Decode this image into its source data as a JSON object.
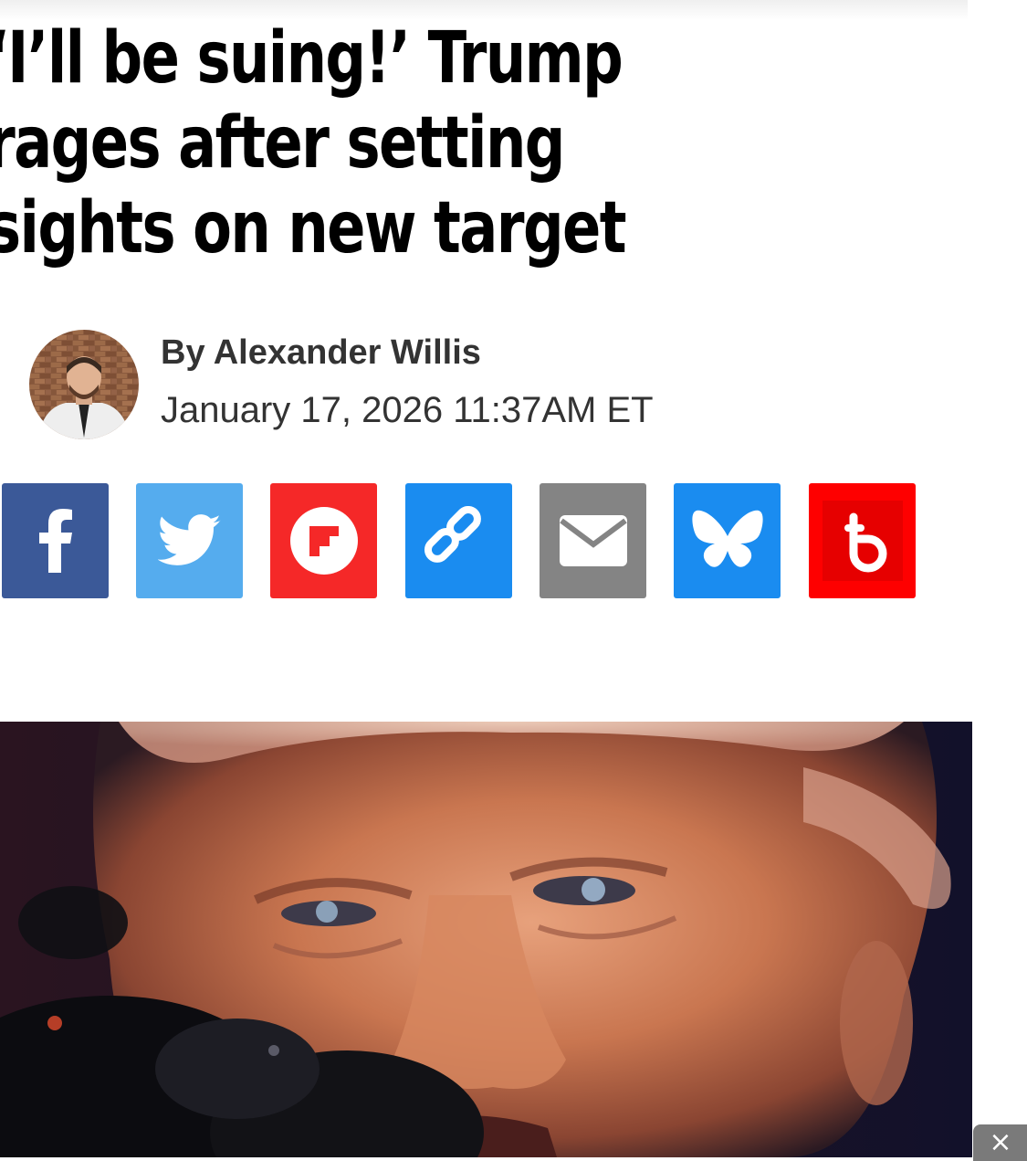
{
  "article": {
    "headline": "‘I’ll be suing!’ Trump rages after setting sights on new target",
    "author": "By Alexander Willis",
    "date": "January 17, 2026 11:37AM ET"
  },
  "share_buttons": [
    {
      "name": "facebook",
      "icon": "facebook-icon",
      "color": "#3b5998"
    },
    {
      "name": "twitter",
      "icon": "twitter-bird-icon",
      "color": "#55acee"
    },
    {
      "name": "flipboard",
      "icon": "flipboard-icon",
      "color": "#f52828"
    },
    {
      "name": "copy-link",
      "icon": "link-icon",
      "color": "#1a8cf0"
    },
    {
      "name": "email",
      "icon": "envelope-icon",
      "color": "#848484"
    },
    {
      "name": "bluesky",
      "icon": "butterfly-icon",
      "color": "#1a8cf0"
    },
    {
      "name": "beehiiv",
      "icon": "beehiiv-icon",
      "color": "#fe0000"
    }
  ],
  "ad": {
    "close_label": "×"
  }
}
